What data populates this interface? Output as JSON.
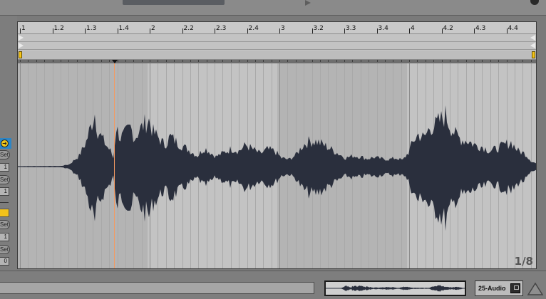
{
  "ruler": {
    "labels": [
      "1",
      "1.2",
      "1.3",
      "1.4",
      "2",
      "2.2",
      "2.3",
      "2.4",
      "3",
      "3.2",
      "3.3",
      "3.4",
      "4",
      "4.2",
      "4.3",
      "4.4"
    ]
  },
  "left_controls": {
    "set_label": "Set",
    "value_1": "1",
    "value_2": "1",
    "value_3": "1",
    "value_4": "0",
    "active_circle_icon": "arrow-right-circle-icon"
  },
  "clip": {
    "page_indicator": "1/8",
    "playhead_icon": "playhead-marker-icon"
  },
  "bottom": {
    "device_label": "25-Audio",
    "triangle_icon": "triangle-up-icon"
  },
  "colors": {
    "waveform": "#2a2f3d",
    "playhead": "#f29a62",
    "loop_flag": "#f5c518",
    "selected_control": "#2d86c6"
  }
}
